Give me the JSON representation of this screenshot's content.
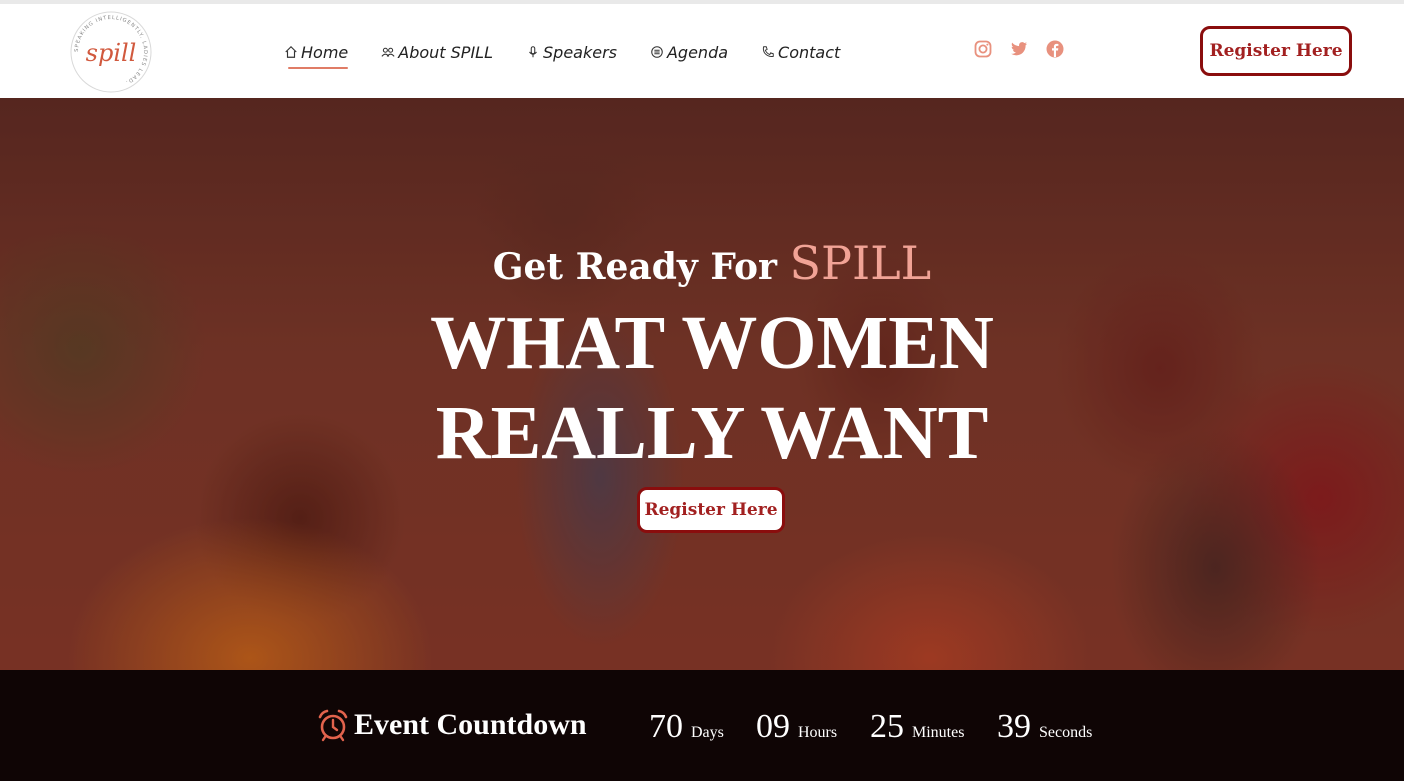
{
  "brand": {
    "logo_text": "spill",
    "logo_ring_text": "SPEAKING INTELLIGENTLY. LADIES LEAD."
  },
  "nav": {
    "items": [
      {
        "label": "Home",
        "icon": "home-icon",
        "active": true
      },
      {
        "label": "About SPILL",
        "icon": "users-icon",
        "active": false
      },
      {
        "label": "Speakers",
        "icon": "microphone-icon",
        "active": false
      },
      {
        "label": "Agenda",
        "icon": "list-icon",
        "active": false
      },
      {
        "label": "Contact",
        "icon": "phone-icon",
        "active": false
      }
    ]
  },
  "socials": [
    "instagram-icon",
    "twitter-icon",
    "facebook-icon"
  ],
  "header": {
    "register_label": "Register Here"
  },
  "hero": {
    "pre_title": "Get Ready For",
    "pre_title_accent": "SPILL",
    "title_line_1": "WHAT WOMEN",
    "title_line_2": "REALLY WANT",
    "register_label": "Register Here"
  },
  "countdown": {
    "label": "Event Countdown",
    "days": "70",
    "days_label": "Days",
    "hours": "09",
    "hours_label": "Hours",
    "minutes": "25",
    "minutes_label": "Minutes",
    "seconds": "39",
    "seconds_label": "Seconds"
  },
  "colors": {
    "accent": "#e07c66",
    "button_border": "#8a0d0d",
    "button_text": "#a22020",
    "countdown_bg": "#0f0505"
  }
}
